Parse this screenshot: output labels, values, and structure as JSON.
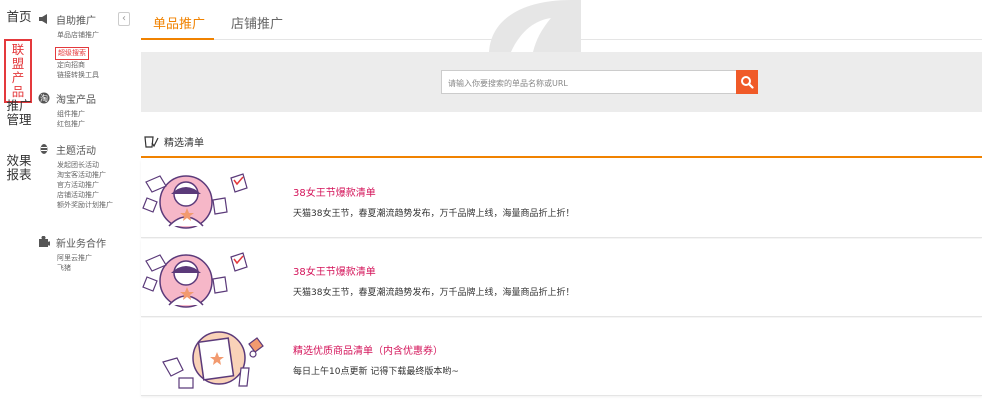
{
  "vnav": [
    {
      "label": "首页",
      "active": false
    },
    {
      "label": "联盟产品",
      "active": true
    },
    {
      "label": "推广管理",
      "active": false
    },
    {
      "label": "效果报表",
      "active": false
    }
  ],
  "sidebar": {
    "collapse_glyph": "‹",
    "groups": [
      {
        "title": "自助推广",
        "icon": "megaphone-icon",
        "items": [
          {
            "label": "单品店铺推广",
            "active": false
          },
          {
            "label": "超级搜索",
            "active": true
          },
          {
            "label": "定向招商",
            "active": false
          },
          {
            "label": "链接转换工具",
            "active": false
          }
        ]
      },
      {
        "title": "淘宝产品",
        "icon": "taobao-icon",
        "items": [
          {
            "label": "组件推广",
            "active": false
          },
          {
            "label": "红包推广",
            "active": false
          }
        ]
      },
      {
        "title": "主题活动",
        "icon": "theme-icon",
        "items": [
          {
            "label": "发起团长活动",
            "active": false
          },
          {
            "label": "淘宝客活动推广",
            "active": false
          },
          {
            "label": "官方活动推广",
            "active": false
          },
          {
            "label": "店铺活动推广",
            "active": false
          },
          {
            "label": "额外奖励计划推广",
            "active": false
          }
        ]
      },
      {
        "title": "新业务合作",
        "icon": "puzzle-icon",
        "items": [
          {
            "label": "阿里云推广",
            "active": false
          },
          {
            "label": "飞猪",
            "active": false
          }
        ]
      }
    ]
  },
  "tabs": [
    {
      "label": "单品推广",
      "active": true
    },
    {
      "label": "店铺推广",
      "active": false
    }
  ],
  "search": {
    "placeholder": "请输入你要搜索的单品名称或URL"
  },
  "section": {
    "title": "精选清单"
  },
  "cards": [
    {
      "title": "38女王节爆款清单",
      "desc": "天猫38女王节，春夏潮流趋势发布，万千品牌上线，海量商品折上折！"
    },
    {
      "title": "38女王节爆款清单",
      "desc": "天猫38女王节，春夏潮流趋势发布，万千品牌上线，海量商品折上折！"
    },
    {
      "title": "精选优质商品清单（内含优惠券）",
      "desc": "每日上午10点更新 记得下载最终版本哟~"
    }
  ],
  "colors": {
    "accent": "#f08200",
    "search_button": "#f05a28",
    "highlight": "#e4393c",
    "card_title": "#d4145a"
  }
}
